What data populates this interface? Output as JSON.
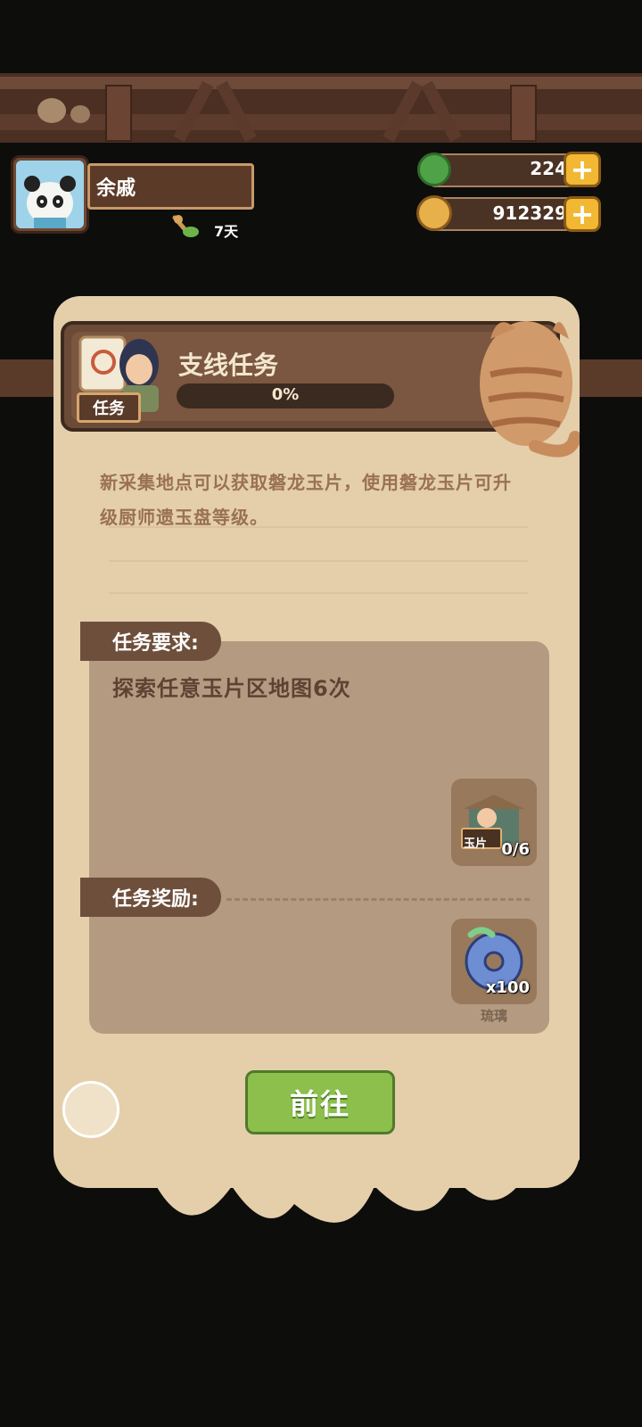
{
  "player": {
    "name": "余戚",
    "days": "7天"
  },
  "resources": [
    {
      "icon": "jade-coin-icon",
      "value": "224"
    },
    {
      "icon": "gold-coin-icon",
      "value": "912329"
    }
  ],
  "task": {
    "tag": "任务",
    "title": "支线任务",
    "progress_text": "0%",
    "progress": 0,
    "description": "新采集地点可以获取磐龙玉片，使用磐龙玉片可升级厨师遗玉盘等级。",
    "requirement_label": "任务要求:",
    "requirement_text": "探索任意玉片区地图6次",
    "requirement_item": {
      "tag": "玉片",
      "count": "0/6"
    },
    "reward_label": "任务奖励:",
    "reward_item": {
      "count": "x100",
      "name": "琉璃"
    },
    "go_button": "前往"
  },
  "colors": {
    "parchment": "#e4cfaa",
    "panel": "#b49a80",
    "button_green": "#8cbf4c",
    "plus_gold": "#f2b733"
  }
}
